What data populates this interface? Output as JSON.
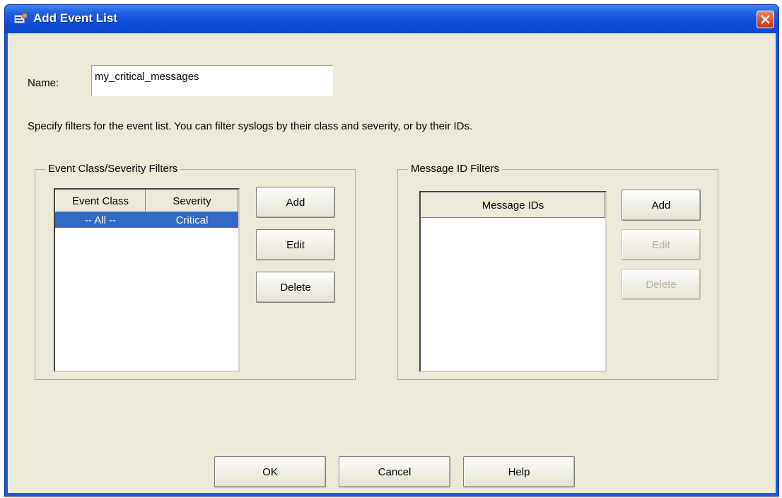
{
  "dialog": {
    "title": "Add Event List"
  },
  "name_field": {
    "label": "Name:",
    "value": "my_critical_messages"
  },
  "description": "Specify filters for the event list. You can filter syslogs by their class and severity, or by their IDs.",
  "class_severity_group": {
    "legend": "Event Class/Severity Filters",
    "columns": [
      "Event Class",
      "Severity"
    ],
    "rows": [
      {
        "event_class": "-- All --",
        "severity": "Critical",
        "selected": true
      }
    ],
    "buttons": {
      "add": "Add",
      "edit": "Edit",
      "delete": "Delete"
    }
  },
  "message_id_group": {
    "legend": "Message ID Filters",
    "columns": [
      "Message IDs"
    ],
    "rows": [],
    "buttons": {
      "add": "Add",
      "edit": "Edit",
      "delete": "Delete"
    },
    "edit_enabled": false,
    "delete_enabled": false
  },
  "footer_buttons": {
    "ok": "OK",
    "cancel": "Cancel",
    "help": "Help"
  },
  "colors": {
    "titlebar": "#0b4bd4",
    "selection": "#316ac5",
    "dialog_bg": "#ece9d8",
    "close_button": "#d94a22"
  },
  "icons": {
    "title": "event-list-icon",
    "close": "close-icon"
  }
}
